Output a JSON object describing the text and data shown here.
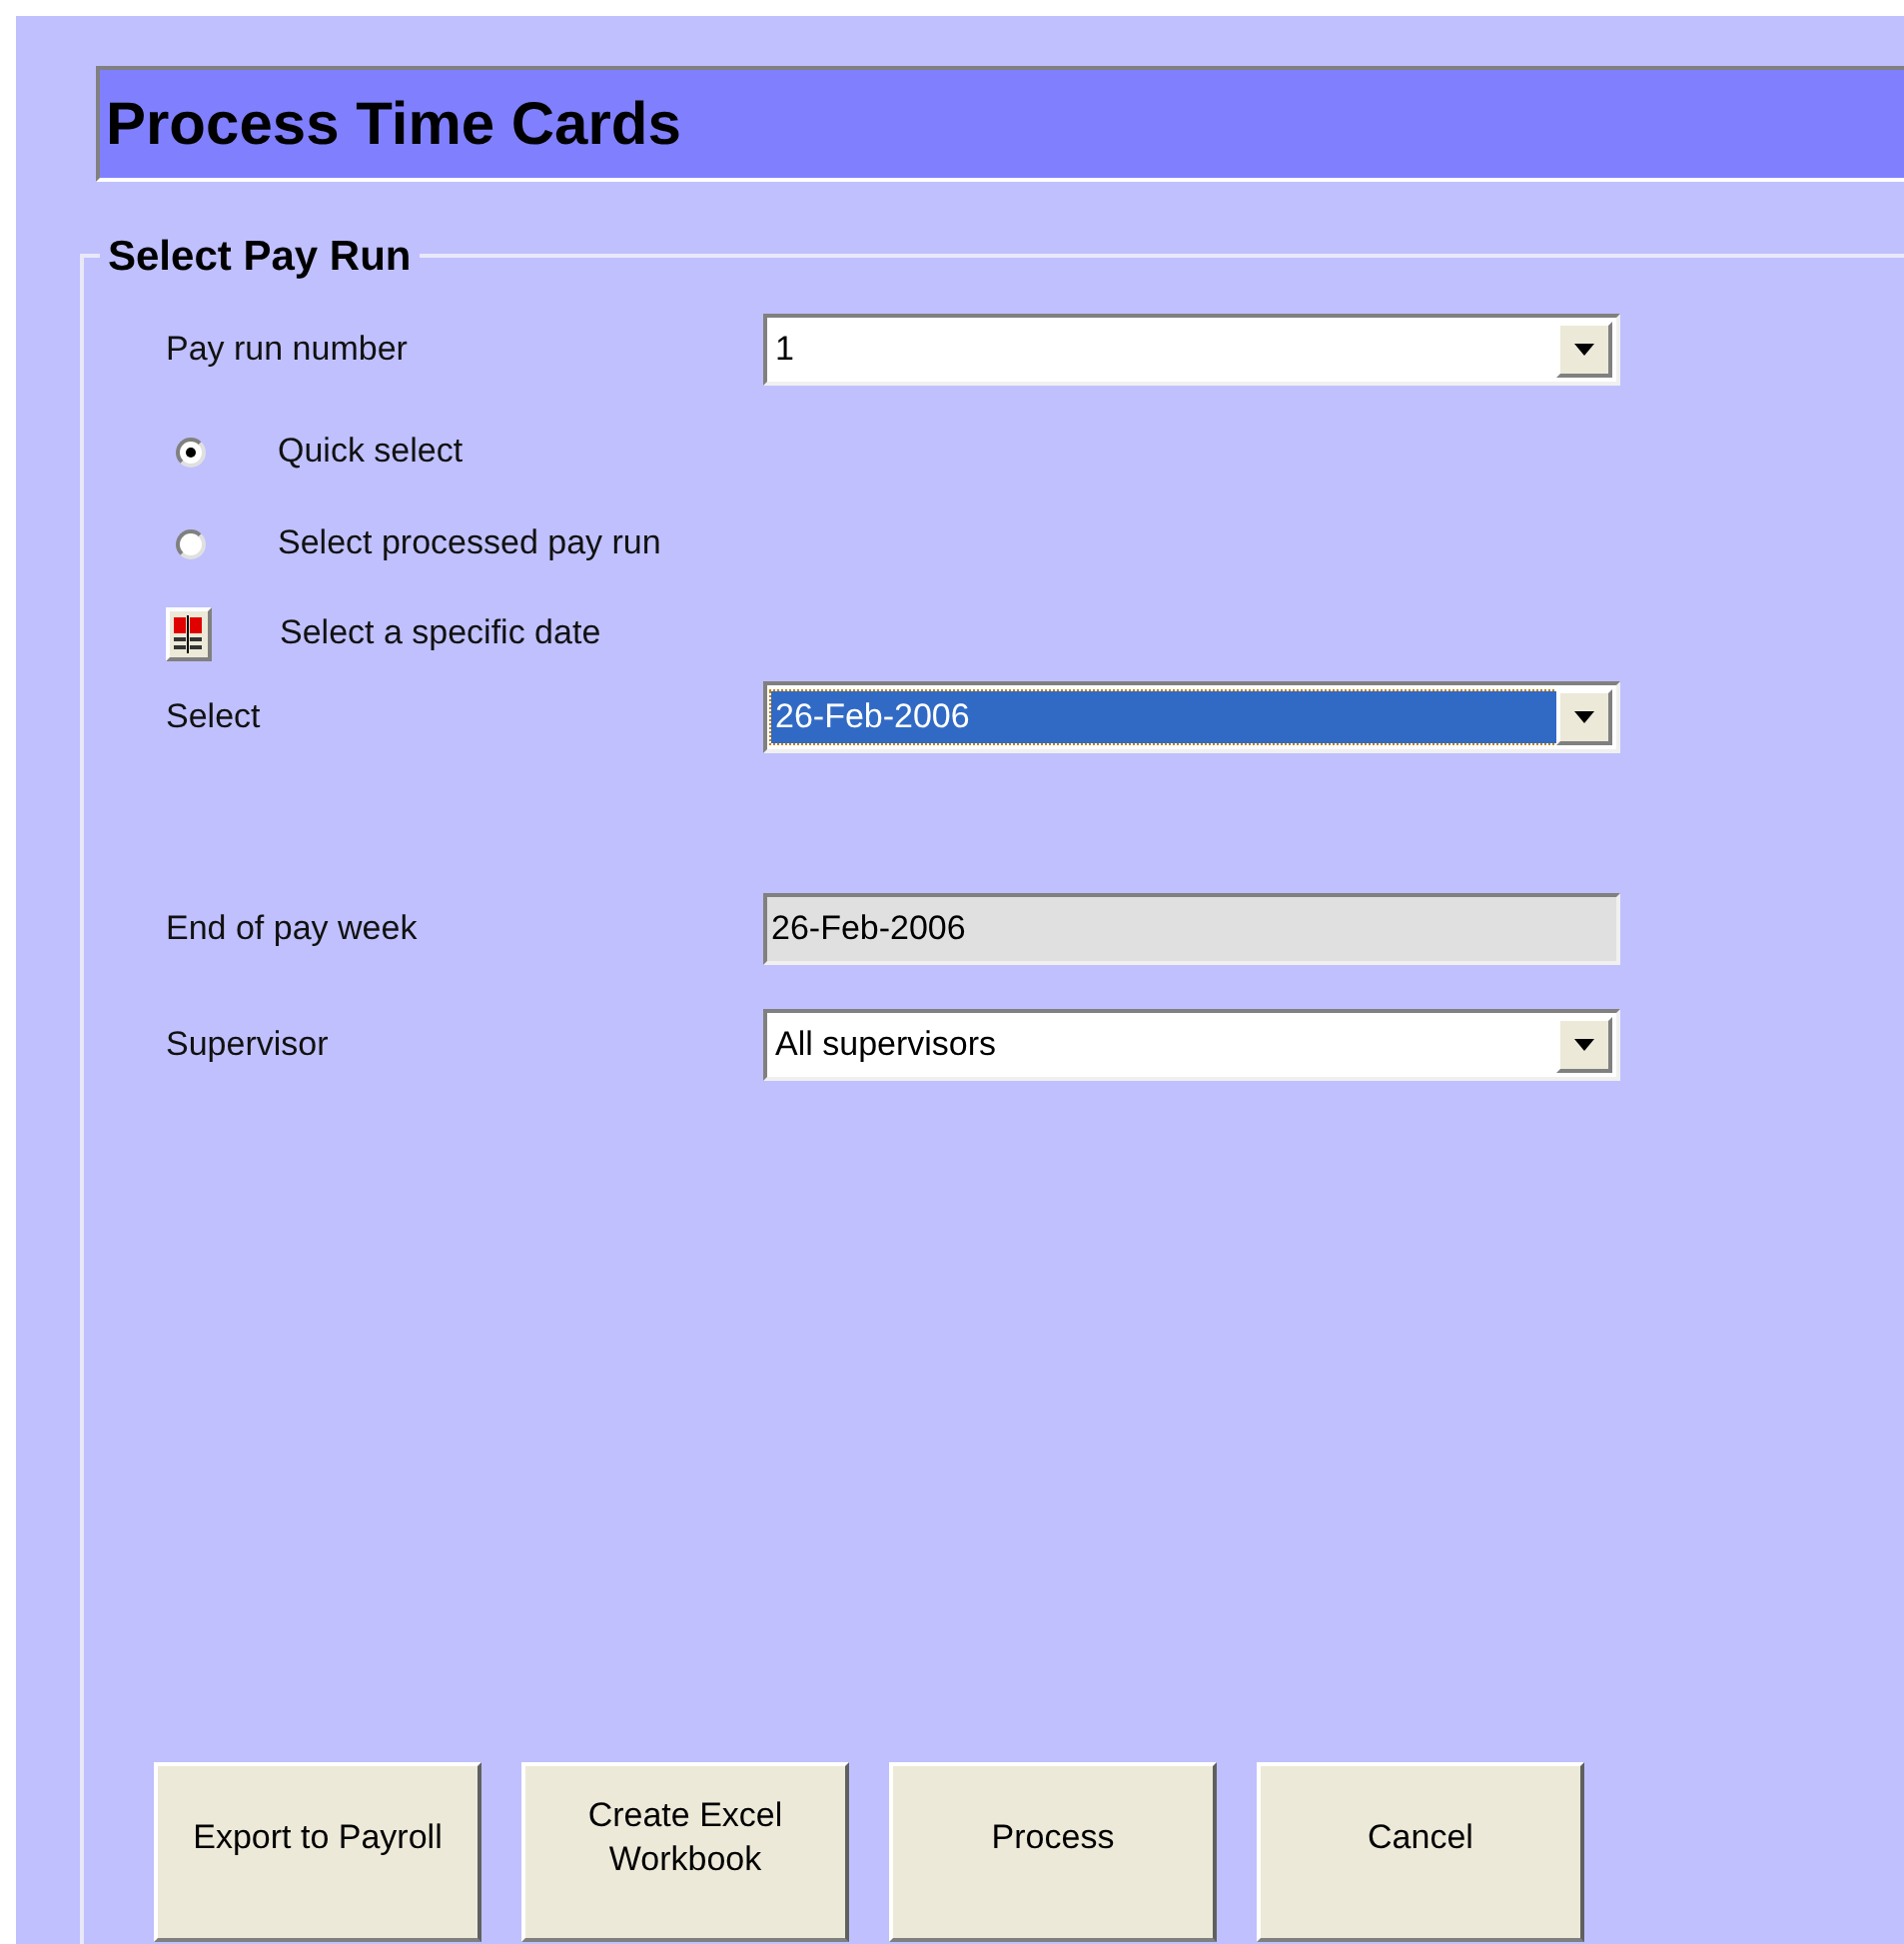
{
  "title": "Process Time Cards",
  "group": {
    "label": "Select Pay Run"
  },
  "pay_run": {
    "label": "Pay run number",
    "value": "1"
  },
  "options": [
    {
      "kind": "radio",
      "label": "Quick select",
      "selected": true
    },
    {
      "kind": "radio",
      "label": "Select processed pay run",
      "selected": false
    },
    {
      "kind": "calendar",
      "label": "Select a specific date"
    }
  ],
  "fields": [
    {
      "kind": "combo",
      "label": "Select",
      "value": "26-Feb-2006",
      "highlighted": true
    },
    {
      "kind": "readonly",
      "label": "End of pay week",
      "value": "26-Feb-2006"
    },
    {
      "kind": "combo",
      "label": "Supervisor",
      "value": "All supervisors",
      "highlighted": false
    }
  ],
  "buttons": [
    "Export to Payroll",
    "Create Excel Workbook",
    "Process",
    "Cancel"
  ]
}
